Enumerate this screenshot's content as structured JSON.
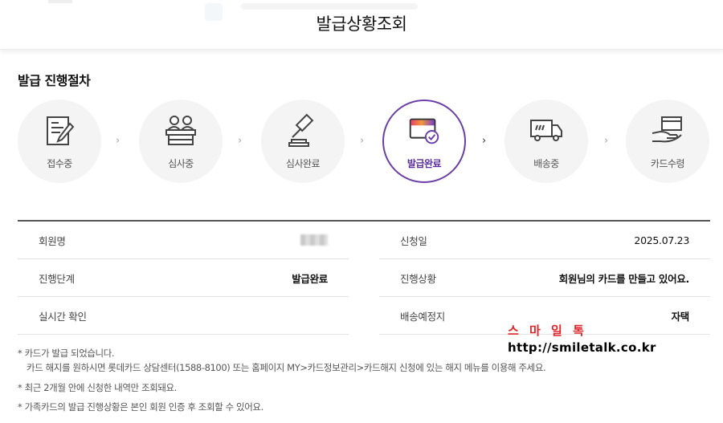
{
  "header": {
    "title": "발급상황조회"
  },
  "process": {
    "title": "발급 진행절차",
    "steps": [
      {
        "label": "접수중",
        "icon": "document-pencil-icon",
        "active": false
      },
      {
        "label": "심사중",
        "icon": "reviewers-icon",
        "active": false
      },
      {
        "label": "심사완료",
        "icon": "gavel-icon",
        "active": false
      },
      {
        "label": "발급완료",
        "icon": "card-check-icon",
        "active": true
      },
      {
        "label": "배송중",
        "icon": "delivery-truck-icon",
        "active": false
      },
      {
        "label": "카드수령",
        "icon": "card-hand-icon",
        "active": false
      }
    ],
    "arrow": "›"
  },
  "info": {
    "left": [
      {
        "key": "회원명",
        "value": ""
      },
      {
        "key": "진행단계",
        "value": "발급완료"
      },
      {
        "key": "실시간 확인",
        "value": ""
      }
    ],
    "right": [
      {
        "key": "신청일",
        "value": "2025.07.23"
      },
      {
        "key": "진행상황",
        "value": "회원님의 카드를 만들고 있어요."
      },
      {
        "key": "배송예정지",
        "value": "자택"
      }
    ]
  },
  "notes": [
    "* 카드가 발급 되었습니다.",
    "카드 해지를 원하시면 롯데카드 상담센터(1588-8100) 또는 홈페이지 MY>카드정보관리>카드해지 신청에 있는 해지 메뉴를 이용해 주세요.",
    "* 최근 2개월 안에 신청한 내역만 조회돼요.",
    "* 가족카드의 발급 진행상황은 본인 회원 인증 후 조회할 수 있어요."
  ],
  "watermark": {
    "line1": "스 마 일 톡",
    "line2": "http://smiletalk.co.kr",
    "colors": [
      "#e0262c",
      "#111111"
    ]
  },
  "colors": {
    "accent": "#6b3fa8",
    "accent_gradient": [
      "#e8436b",
      "#f29a35",
      "#7b3fd0"
    ]
  }
}
